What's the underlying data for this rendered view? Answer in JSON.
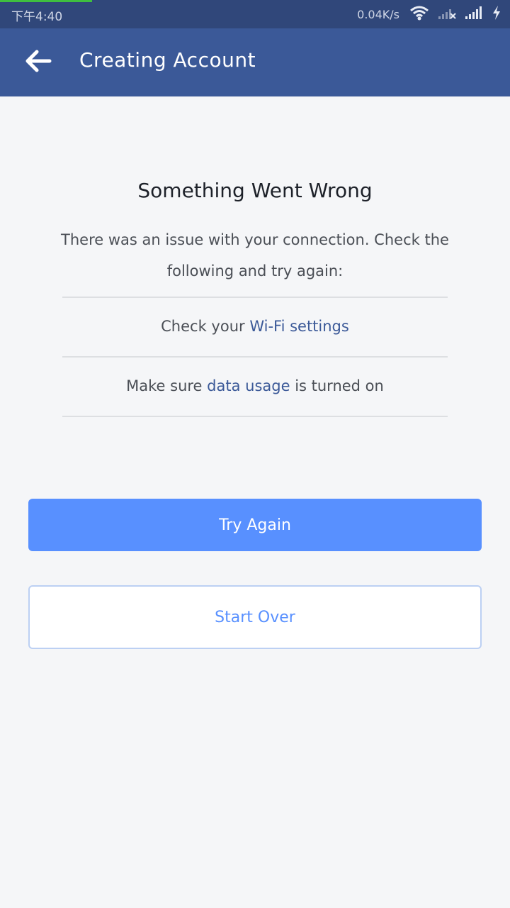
{
  "status_bar": {
    "time": "下午4:40",
    "network_speed": "0.04K/s",
    "icons": [
      "wifi-icon",
      "signal-off-icon",
      "signal-icon",
      "charging-icon"
    ]
  },
  "app_bar": {
    "back_icon": "arrow-left-icon",
    "title": "Creating Account"
  },
  "error": {
    "title": "Something Went Wrong",
    "message": "There was an issue with your connection. Check the following and try again:",
    "checks": [
      {
        "before": "Check your ",
        "link": "Wi-Fi settings",
        "after": ""
      },
      {
        "before": "Make sure ",
        "link": "data usage",
        "after": " is turned on"
      }
    ]
  },
  "buttons": {
    "try_again": "Try Again",
    "start_over": "Start Over"
  },
  "colors": {
    "brand": "#3b5998",
    "status_bar": "#30477a",
    "primary_button": "#5890ff",
    "progress": "#3fbf3f"
  }
}
